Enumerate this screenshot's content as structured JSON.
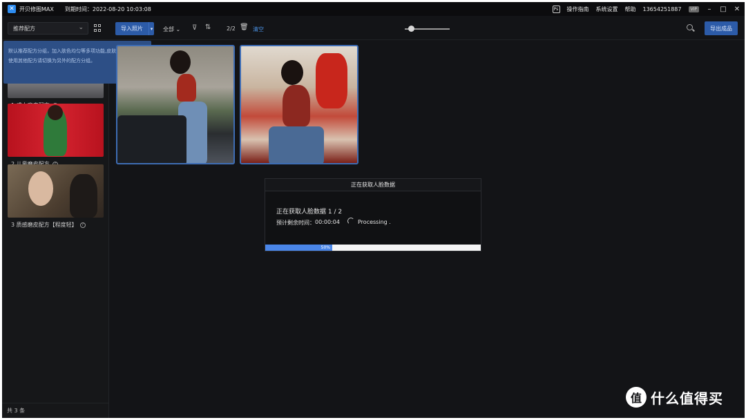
{
  "titlebar": {
    "app_name": "开贝修图MAX",
    "expire": "到期时间：2022-08-20 10:03:08",
    "ps_icon": "Ps",
    "guide": "操作指南",
    "settings": "系统设置",
    "help": "帮助",
    "account": "13654251887",
    "vip": "VIP",
    "minimize": "–",
    "maximize": "□",
    "close": "✕"
  },
  "toolbar": {
    "scheme_select": "推荐配方",
    "import_label": "导入照片",
    "filter_all": "全部",
    "count": "2/2",
    "clear_label": "清空",
    "export_label": "导出成品",
    "zoom_level": 0.15
  },
  "tooltip": {
    "line1": "默认推荐配方分组，加入肤色均匀等多项功能,皮肤水润光泽。",
    "line2": "使用其他配方请切换为另外的配方分组。"
  },
  "schemes": [
    {
      "label": "1 成人磨皮配方"
    },
    {
      "label": "2 儿童磨皮配方"
    },
    {
      "label": "3 质感磨皮配方【程度轻】"
    }
  ],
  "sidebar_footer": "共 3 条",
  "dialog": {
    "title": "正在获取人脸数据",
    "message": "正在获取人脸数据 1 / 2",
    "remain_label": "预计剩余时间：",
    "remain_value": "00:00:04",
    "status": "Processing .",
    "progress": 0.5,
    "progress_label": "50%"
  },
  "watermark": "什么值得买",
  "colors": {
    "accent": "#2c5ba8",
    "link": "#4a90e2",
    "progress": "#4a86e8",
    "background": "#131417"
  }
}
